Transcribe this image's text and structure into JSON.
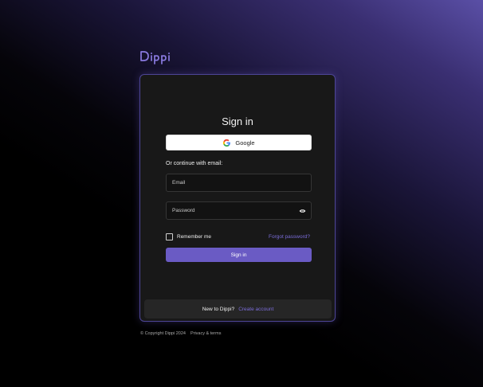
{
  "brand": {
    "name": "Dippi",
    "accent_color": "#6a5bc4",
    "link_color": "#7a6cd8"
  },
  "signin_card": {
    "title": "Sign in",
    "google_button_label": "Google",
    "or_text": "Or continue with email:",
    "email_placeholder": "Email",
    "password_placeholder": "Password",
    "remember_label": "Remember me",
    "remember_checked": false,
    "forgot_label": "Forgot password?",
    "submit_label": "Sign in"
  },
  "signup_prompt": {
    "text": "New to Dippi?",
    "link_label": "Create account"
  },
  "page_footer": {
    "copyright": "© Copyright Dippi 2024",
    "privacy_label": "Privacy & terms"
  }
}
